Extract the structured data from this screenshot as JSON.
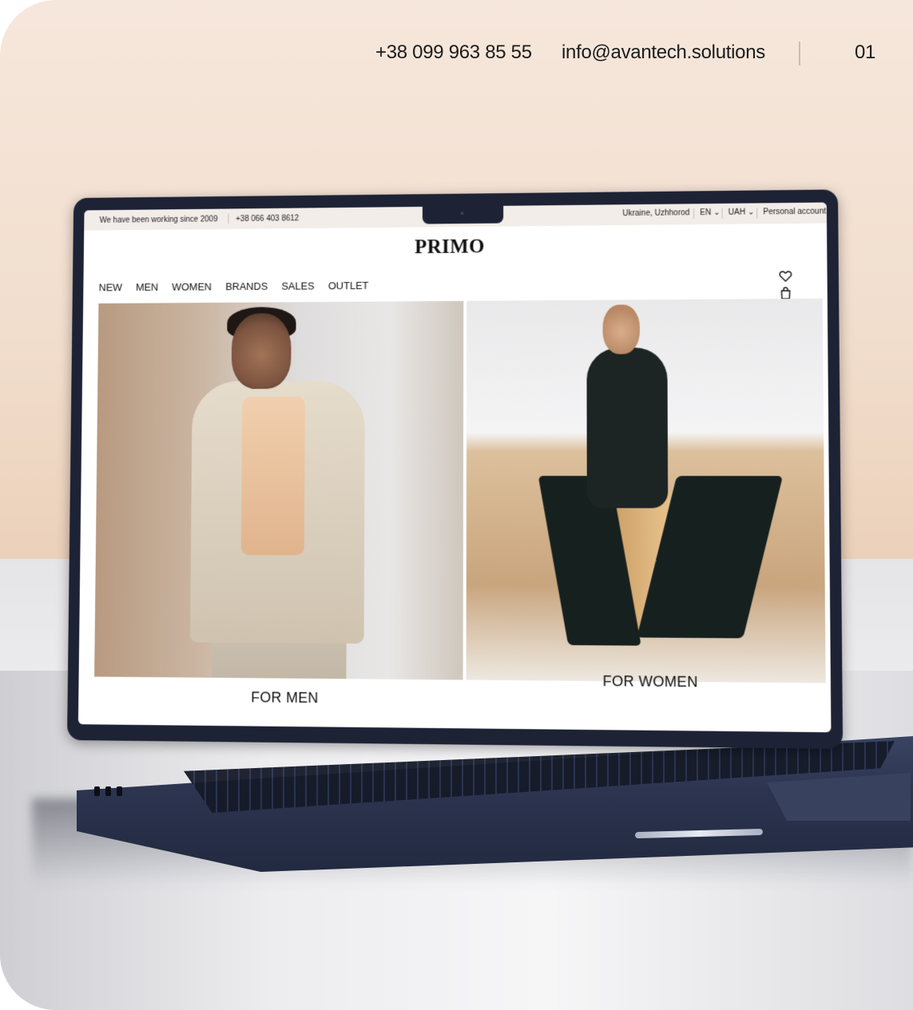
{
  "header": {
    "phone": "+38 099 963 85 55",
    "email": "info@avantech.solutions",
    "page_number": "01"
  },
  "site": {
    "topbar": {
      "working_since": "We have been working since 2009",
      "phone": "+38 066 403 8612",
      "location": "Ukraine, Uzhhorod",
      "language": "EN",
      "currency": "UAH",
      "account": "Personal account"
    },
    "logo": "PRIMO",
    "nav": [
      "NEW",
      "MEN",
      "WOMEN",
      "BRANDS",
      "SALES",
      "OUTLET"
    ],
    "icons": [
      "heart-icon",
      "shopping-bag-icon"
    ],
    "panels": [
      {
        "caption": "FOR MEN"
      },
      {
        "caption": "FOR WOMEN"
      }
    ]
  }
}
